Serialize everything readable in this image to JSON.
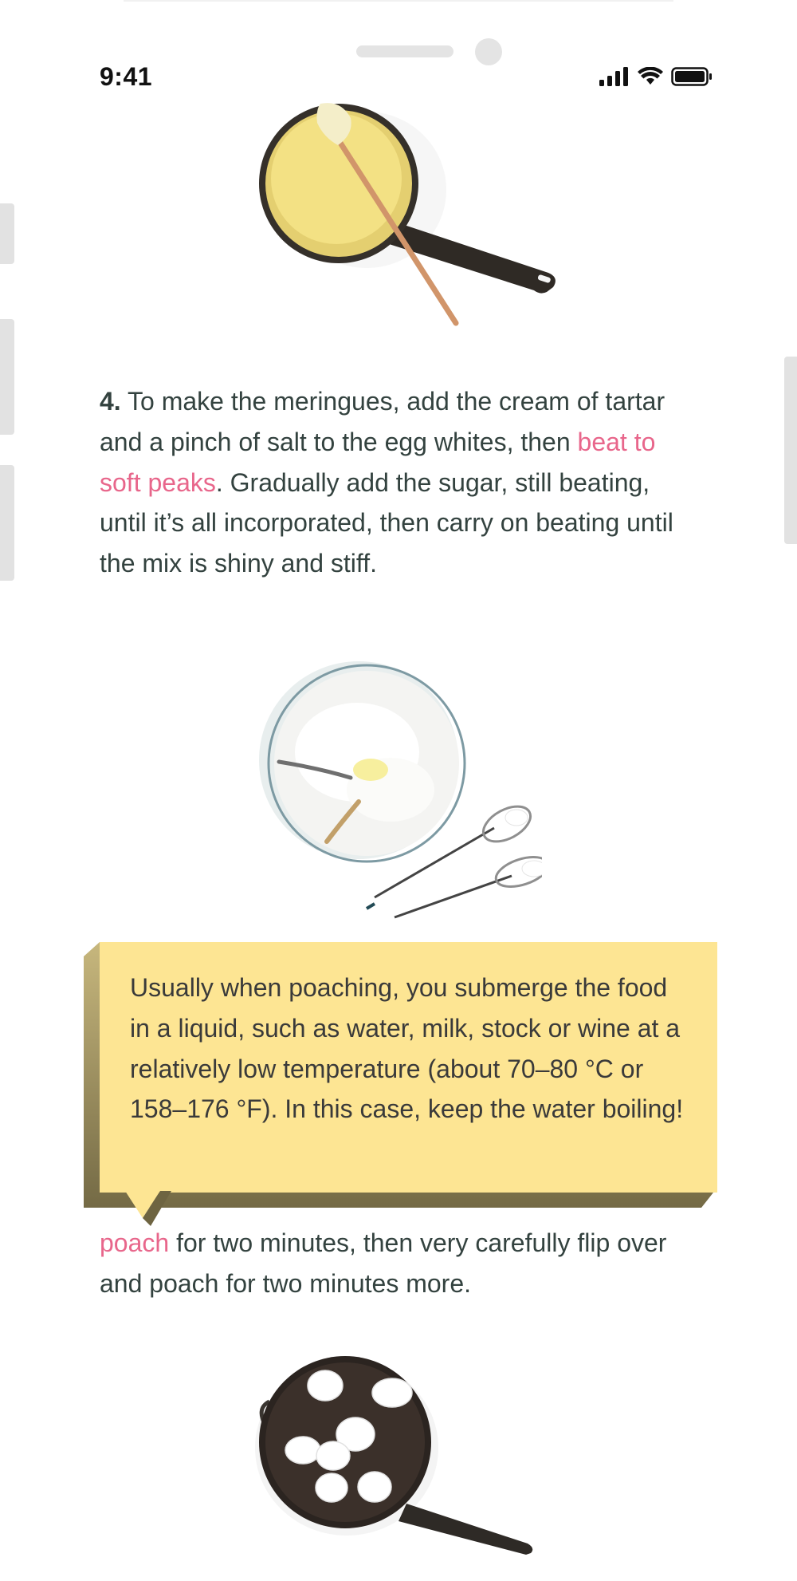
{
  "status_bar": {
    "time": "9:41",
    "icons": [
      "signal-icon",
      "wifi-icon",
      "battery-icon"
    ]
  },
  "step4": {
    "number": "4.",
    "text_before": " To make the meringues, add the cream of tartar and a pinch of salt to the egg whites, then ",
    "link": "beat to soft peaks",
    "text_after": ". Gradually add the sugar, still beating, until it’s all incorporated, then carry on beating until the mix is shiny and stiff."
  },
  "tooltip": {
    "text": "Usually when poaching, you submerge the food in a liquid, such as water, milk, stock or wine at a relatively low temperature (about 70–80 °C or 158–176 °F). In this case, keep the water boiling!"
  },
  "step5": {
    "link": "poach",
    "text_after": " for two minutes, then very carefully flip over and poach for two minutes more."
  },
  "colors": {
    "link": "#e8668b",
    "text": "#33423f",
    "tooltip_bg": "#fde593",
    "tooltip_shadow": "#8a7e55"
  }
}
